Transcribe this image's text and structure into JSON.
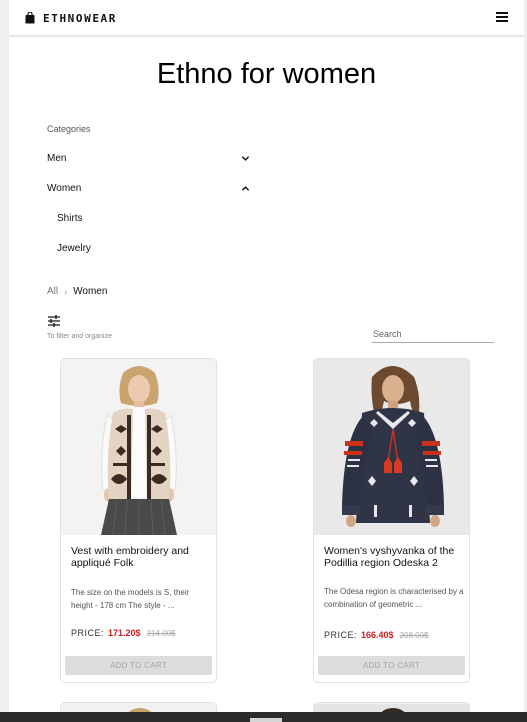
{
  "header": {
    "brand": "ETHNOWEAR",
    "logo_icon": "shopping-bag-icon",
    "menu_icon": "hamburger-menu-icon"
  },
  "page": {
    "title": "Ethno for women"
  },
  "categories": {
    "heading": "Categories",
    "items": [
      {
        "label": "Men",
        "icon": "chevron-down-icon"
      },
      {
        "label": "Women",
        "icon": "chevron-up-icon"
      }
    ],
    "subitems": [
      {
        "label": "Shirts"
      },
      {
        "label": "Jewelry"
      }
    ]
  },
  "breadcrumb": {
    "root": "All",
    "separator": "›",
    "current": "Women"
  },
  "filter": {
    "icon": "sliders-icon",
    "hint": "To filter and organize"
  },
  "search": {
    "placeholder": "Search",
    "value": ""
  },
  "products": [
    {
      "name": "Vest with embroidery and appliqué Folk",
      "description": "The size on the models is S, their height - 178 cm The style - ...",
      "price_label": "PRICE:",
      "price": "171.20$",
      "old_price": "214.00$",
      "button": "ADD TO CART"
    },
    {
      "name": "Women's vyshyvanka of the Podillia region Odeska 2",
      "description": "The Odesa region is characterised by a combination of geometric ...",
      "price_label": "PRICE:",
      "price": "166.40$",
      "old_price": "208.00$",
      "button": "ADD TO CART"
    }
  ],
  "colors": {
    "accent_price": "#cc1f1f",
    "button_bg": "#dcdcdc",
    "button_text": "#a5a5a5",
    "blouse": "#2f3547",
    "embroidery_red": "#c8321d"
  }
}
